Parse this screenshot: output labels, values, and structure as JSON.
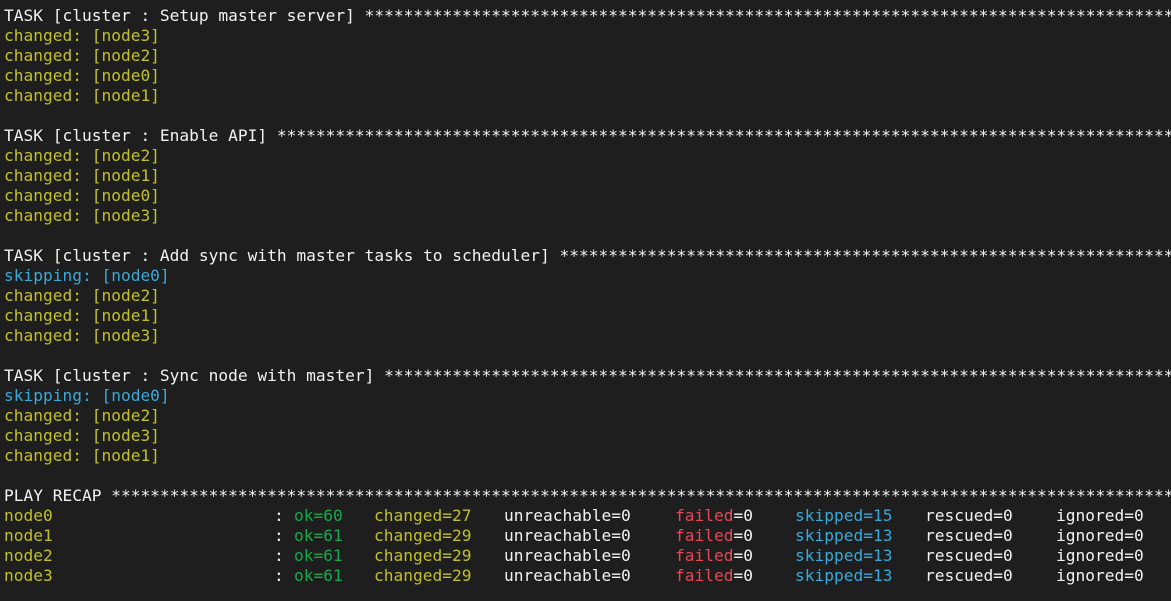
{
  "tasks": [
    {
      "header": "TASK [cluster : Setup master server] ****************************************************************************************",
      "results": [
        {
          "status": "changed",
          "text": "changed: [node3]"
        },
        {
          "status": "changed",
          "text": "changed: [node2]"
        },
        {
          "status": "changed",
          "text": "changed: [node0]"
        },
        {
          "status": "changed",
          "text": "changed: [node1]"
        }
      ]
    },
    {
      "header": "TASK [cluster : Enable API] *************************************************************************************************",
      "results": [
        {
          "status": "changed",
          "text": "changed: [node2]"
        },
        {
          "status": "changed",
          "text": "changed: [node1]"
        },
        {
          "status": "changed",
          "text": "changed: [node0]"
        },
        {
          "status": "changed",
          "text": "changed: [node3]"
        }
      ]
    },
    {
      "header": "TASK [cluster : Add sync with master tasks to scheduler] ****************************************************************",
      "results": [
        {
          "status": "skipping",
          "text": "skipping: [node0]"
        },
        {
          "status": "changed",
          "text": "changed: [node2]"
        },
        {
          "status": "changed",
          "text": "changed: [node1]"
        },
        {
          "status": "changed",
          "text": "changed: [node3]"
        }
      ]
    },
    {
      "header": "TASK [cluster : Sync node with master] **************************************************************************************",
      "results": [
        {
          "status": "skipping",
          "text": "skipping: [node0]"
        },
        {
          "status": "changed",
          "text": "changed: [node2]"
        },
        {
          "status": "changed",
          "text": "changed: [node3]"
        },
        {
          "status": "changed",
          "text": "changed: [node1]"
        }
      ]
    }
  ],
  "recap": {
    "header": "PLAY RECAP ******************************************************************************************************************",
    "rows": [
      {
        "host": "node0",
        "colon": ":",
        "ok_label": "ok",
        "ok": "60",
        "changed_label": "changed",
        "changed": "27",
        "unreachable_label": "unreachable",
        "unreachable": "0",
        "failed_label": "failed",
        "failed": "0",
        "skipped_label": "skipped",
        "skipped": "15",
        "rescued_label": "rescued",
        "rescued": "0",
        "ignored_label": "ignored",
        "ignored": "0"
      },
      {
        "host": "node1",
        "colon": ":",
        "ok_label": "ok",
        "ok": "61",
        "changed_label": "changed",
        "changed": "29",
        "unreachable_label": "unreachable",
        "unreachable": "0",
        "failed_label": "failed",
        "failed": "0",
        "skipped_label": "skipped",
        "skipped": "13",
        "rescued_label": "rescued",
        "rescued": "0",
        "ignored_label": "ignored",
        "ignored": "0"
      },
      {
        "host": "node2",
        "colon": ":",
        "ok_label": "ok",
        "ok": "61",
        "changed_label": "changed",
        "changed": "29",
        "unreachable_label": "unreachable",
        "unreachable": "0",
        "failed_label": "failed",
        "failed": "0",
        "skipped_label": "skipped",
        "skipped": "13",
        "rescued_label": "rescued",
        "rescued": "0",
        "ignored_label": "ignored",
        "ignored": "0"
      },
      {
        "host": "node3",
        "colon": ":",
        "ok_label": "ok",
        "ok": "61",
        "changed_label": "changed",
        "changed": "29",
        "unreachable_label": "unreachable",
        "unreachable": "0",
        "failed_label": "failed",
        "failed": "0",
        "skipped_label": "skipped",
        "skipped": "13",
        "rescued_label": "rescued",
        "rescued": "0",
        "ignored_label": "ignored",
        "ignored": "0"
      }
    ]
  },
  "colors": {
    "background": "#1e1e1e",
    "text": "#f2f2f2",
    "changed": "#c1c02a",
    "skipping": "#3aa9d8",
    "ok": "#15a94a",
    "failed": "#e74856"
  }
}
